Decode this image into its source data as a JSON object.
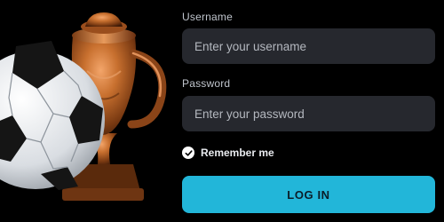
{
  "form": {
    "username_label": "Username",
    "username_placeholder": "Enter your username",
    "username_value": "",
    "password_label": "Password",
    "password_placeholder": "Enter your password",
    "password_value": "",
    "remember_label": "Remember me",
    "remember_checked": true,
    "login_label": "LOG IN"
  },
  "colors": {
    "background": "#000000",
    "input_bg": "#26282e",
    "accent": "#22b6d9",
    "label": "#bfc4cc",
    "trophy": "#b8652a"
  },
  "icons": {
    "check": "check-icon"
  },
  "images": {
    "hero": [
      "soccer-ball",
      "trophy"
    ]
  }
}
